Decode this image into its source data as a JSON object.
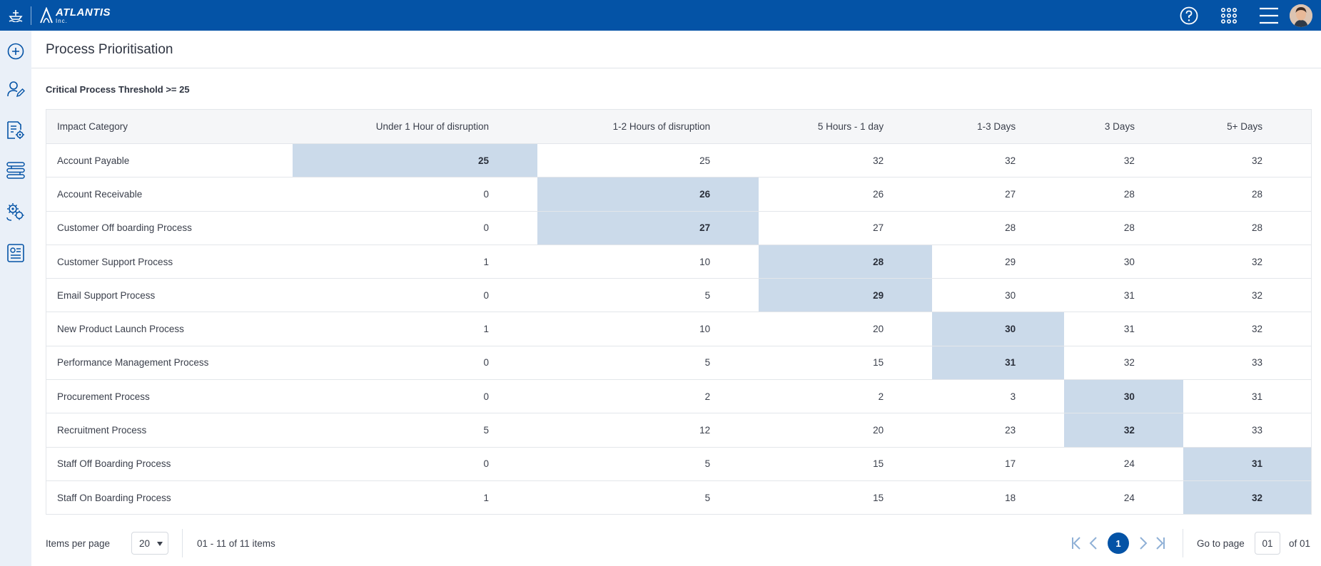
{
  "brand": {
    "name": "ATLANTIS",
    "sub": "Inc."
  },
  "icons": {
    "topbar": [
      "ship-logo-icon",
      "help-icon",
      "apps-grid-icon",
      "hamburger-menu-icon",
      "user-avatar"
    ],
    "sidebar": [
      "add-circle-icon",
      "user-edit-icon",
      "document-settings-icon",
      "process-flow-icon",
      "gears-process-icon",
      "report-card-icon"
    ]
  },
  "page": {
    "title": "Process Prioritisation",
    "threshold_label": "Critical Process Threshold >= 25"
  },
  "table": {
    "headers": [
      "Impact Category",
      "Under 1 Hour of disruption",
      "1-2 Hours of disruption",
      "5 Hours - 1 day",
      "1-3 Days",
      "3 Days",
      "5+ Days"
    ],
    "rows": [
      {
        "name": "Account Payable",
        "values": [
          "25",
          "25",
          "32",
          "32",
          "32",
          "32"
        ],
        "critical_col": 0
      },
      {
        "name": "Account Receivable",
        "values": [
          "0",
          "26",
          "26",
          "27",
          "28",
          "28"
        ],
        "critical_col": 1
      },
      {
        "name": "Customer Off boarding Process",
        "values": [
          "0",
          "27",
          "27",
          "28",
          "28",
          "28"
        ],
        "critical_col": 1
      },
      {
        "name": "Customer Support Process",
        "values": [
          "1",
          "10",
          "28",
          "29",
          "30",
          "32"
        ],
        "critical_col": 2
      },
      {
        "name": "Email Support Process",
        "values": [
          "0",
          "5",
          "29",
          "30",
          "31",
          "32"
        ],
        "critical_col": 2
      },
      {
        "name": "New Product Launch Process",
        "values": [
          "1",
          "10",
          "20",
          "30",
          "31",
          "32"
        ],
        "critical_col": 3
      },
      {
        "name": "Performance Management Process",
        "values": [
          "0",
          "5",
          "15",
          "31",
          "32",
          "33"
        ],
        "critical_col": 3
      },
      {
        "name": "Procurement Process",
        "values": [
          "0",
          "2",
          "2",
          "3",
          "30",
          "31"
        ],
        "critical_col": 4
      },
      {
        "name": "Recruitment Process",
        "values": [
          "5",
          "12",
          "20",
          "23",
          "32",
          "33"
        ],
        "critical_col": 4
      },
      {
        "name": "Staff Off Boarding Process",
        "values": [
          "0",
          "5",
          "15",
          "17",
          "24",
          "31"
        ],
        "critical_col": 5
      },
      {
        "name": "Staff On Boarding Process",
        "values": [
          "1",
          "5",
          "15",
          "18",
          "24",
          "32"
        ],
        "critical_col": 5
      }
    ]
  },
  "pagination": {
    "items_per_page_label": "Items per page",
    "items_per_page_value": "20",
    "range_text": "01 - 11 of 11 items",
    "current_page": "1",
    "goto_label": "Go to page",
    "goto_value": "01",
    "of_text": "of 01"
  },
  "colors": {
    "brand": "#0453a6",
    "highlight": "#cbdaea",
    "sidebar": "#eaf0f8"
  }
}
